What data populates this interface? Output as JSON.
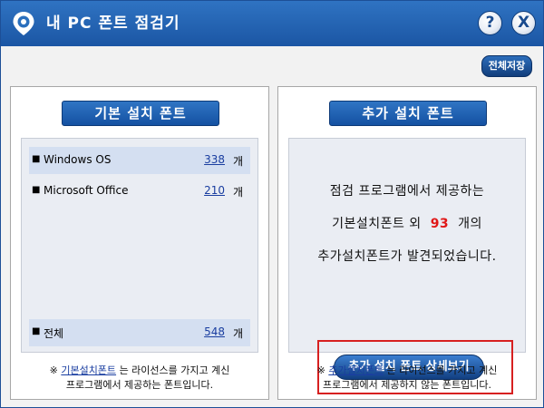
{
  "window": {
    "title": "내 PC 폰트 점검기",
    "help_label": "?",
    "close_label": "X",
    "save_all_label": "전체저장"
  },
  "left_panel": {
    "title": "기본 설치 폰트",
    "rows": [
      {
        "bullet": "■",
        "label": "Windows OS",
        "count": "338",
        "unit": "개"
      },
      {
        "bullet": "■",
        "label": "Microsoft Office",
        "count": "210",
        "unit": "개"
      }
    ],
    "total": {
      "bullet": "■",
      "label": "전체",
      "count": "548",
      "unit": "개"
    },
    "note": {
      "prefix": "※",
      "link": "기본설치폰트",
      "line1_rest": "는 라이선스를 가지고 계신",
      "line2": "프로그램에서 제공하는 폰트입니다."
    }
  },
  "right_panel": {
    "title": "추가 설치 폰트",
    "message": {
      "line1": "점검 프로그램에서 제공하는",
      "line2_before": "기본설치폰트 외",
      "line2_number": "93",
      "line2_after": "개의",
      "line3": "추가설치폰트가 발견되었습니다."
    },
    "detail_button_label": "추가 설치 폰트 상세보기",
    "note": {
      "prefix": "※",
      "link": "추가설치폰트",
      "line1_rest": "는 라이선스를 가지고 계신",
      "line2": "프로그램에서 제공하지 않는 폰트입니다."
    }
  },
  "colors": {
    "titlebar": "#1f5eab",
    "accent_link": "#1a3ea0",
    "highlight_number": "#e01717",
    "highlight_frame": "#d72020"
  },
  "icons": {
    "app_logo": "location-pin-logo",
    "help": "question-icon",
    "close": "close-icon"
  }
}
